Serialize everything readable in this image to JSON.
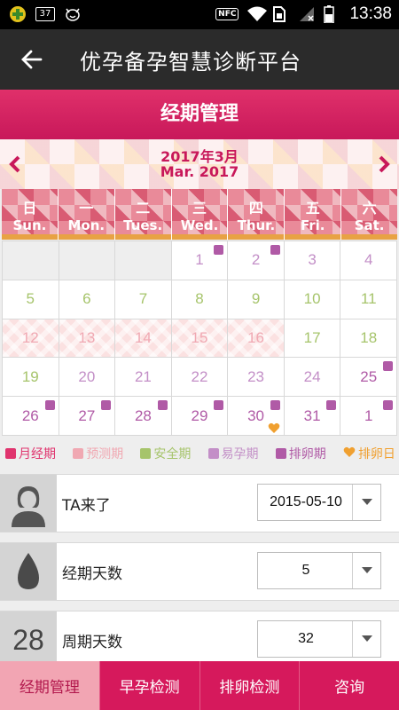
{
  "status_bar": {
    "badge": "37",
    "nfc": "NFC",
    "time": "13:38"
  },
  "app_bar": {
    "title": "优孕备孕智慧诊断平台"
  },
  "section": {
    "title": "经期管理"
  },
  "calendar": {
    "month_zh": "2017年3月",
    "month_en": "Mar. 2017",
    "weekdays": [
      {
        "zh": "日",
        "en": "Sun."
      },
      {
        "zh": "一",
        "en": "Mon."
      },
      {
        "zh": "二",
        "en": "Tues."
      },
      {
        "zh": "三",
        "en": "Wed."
      },
      {
        "zh": "四",
        "en": "Thur."
      },
      {
        "zh": "五",
        "en": "Fri."
      },
      {
        "zh": "六",
        "en": "Sat."
      }
    ],
    "colors": {
      "fertile": "#c38fc7",
      "safe": "#a6c46b",
      "predicted": "#f0a8b2",
      "marker": "#b05aa6",
      "heart": "#f0a030"
    },
    "cells": [
      {
        "day": "",
        "type": "blank"
      },
      {
        "day": "",
        "type": "blank"
      },
      {
        "day": "",
        "type": "blank"
      },
      {
        "day": "1",
        "type": "fertile",
        "mark": true
      },
      {
        "day": "2",
        "type": "fertile",
        "mark": true
      },
      {
        "day": "3",
        "type": "fertile"
      },
      {
        "day": "4",
        "type": "fertile"
      },
      {
        "day": "5",
        "type": "safe"
      },
      {
        "day": "6",
        "type": "safe"
      },
      {
        "day": "7",
        "type": "safe"
      },
      {
        "day": "8",
        "type": "safe"
      },
      {
        "day": "9",
        "type": "safe"
      },
      {
        "day": "10",
        "type": "safe"
      },
      {
        "day": "11",
        "type": "safe"
      },
      {
        "day": "12",
        "type": "predicted"
      },
      {
        "day": "13",
        "type": "predicted"
      },
      {
        "day": "14",
        "type": "predicted"
      },
      {
        "day": "15",
        "type": "predicted"
      },
      {
        "day": "16",
        "type": "predicted"
      },
      {
        "day": "17",
        "type": "safe"
      },
      {
        "day": "18",
        "type": "safe"
      },
      {
        "day": "19",
        "type": "safe"
      },
      {
        "day": "20",
        "type": "fertile"
      },
      {
        "day": "21",
        "type": "fertile"
      },
      {
        "day": "22",
        "type": "fertile"
      },
      {
        "day": "23",
        "type": "fertile"
      },
      {
        "day": "24",
        "type": "fertile"
      },
      {
        "day": "25",
        "type": "ovulation",
        "mark": true
      },
      {
        "day": "26",
        "type": "ovulation",
        "mark": true
      },
      {
        "day": "27",
        "type": "ovulation",
        "mark": true
      },
      {
        "day": "28",
        "type": "ovulation",
        "mark": true
      },
      {
        "day": "29",
        "type": "ovulation",
        "mark": true
      },
      {
        "day": "30",
        "type": "ovulation",
        "mark": true,
        "heart": true
      },
      {
        "day": "31",
        "type": "ovulation",
        "mark": true
      },
      {
        "day": "1",
        "type": "ovulation",
        "mark": true
      }
    ]
  },
  "legend": [
    {
      "label": "月经期",
      "color": "#e0346e"
    },
    {
      "label": "预测期",
      "color": "#f0a8b2"
    },
    {
      "label": "安全期",
      "color": "#a6c46b"
    },
    {
      "label": "易孕期",
      "color": "#c38fc7"
    },
    {
      "label": "排卵期",
      "color": "#b05aa6"
    },
    {
      "label": "排卵日",
      "color": "#f0a030",
      "icon": "heart-icon"
    }
  ],
  "settings": {
    "last_period": {
      "label": "TA来了",
      "value": "2015-05-10",
      "icon": "woman-avatar-icon"
    },
    "period_days": {
      "label": "经期天数",
      "value": "5",
      "icon": "drop-icon"
    },
    "cycle_days": {
      "label": "周期天数",
      "value": "32",
      "icon_text": "28"
    }
  },
  "tabs": [
    {
      "label": "经期管理",
      "active": true
    },
    {
      "label": "早孕检测"
    },
    {
      "label": "排卵检测"
    },
    {
      "label": "咨询"
    }
  ]
}
